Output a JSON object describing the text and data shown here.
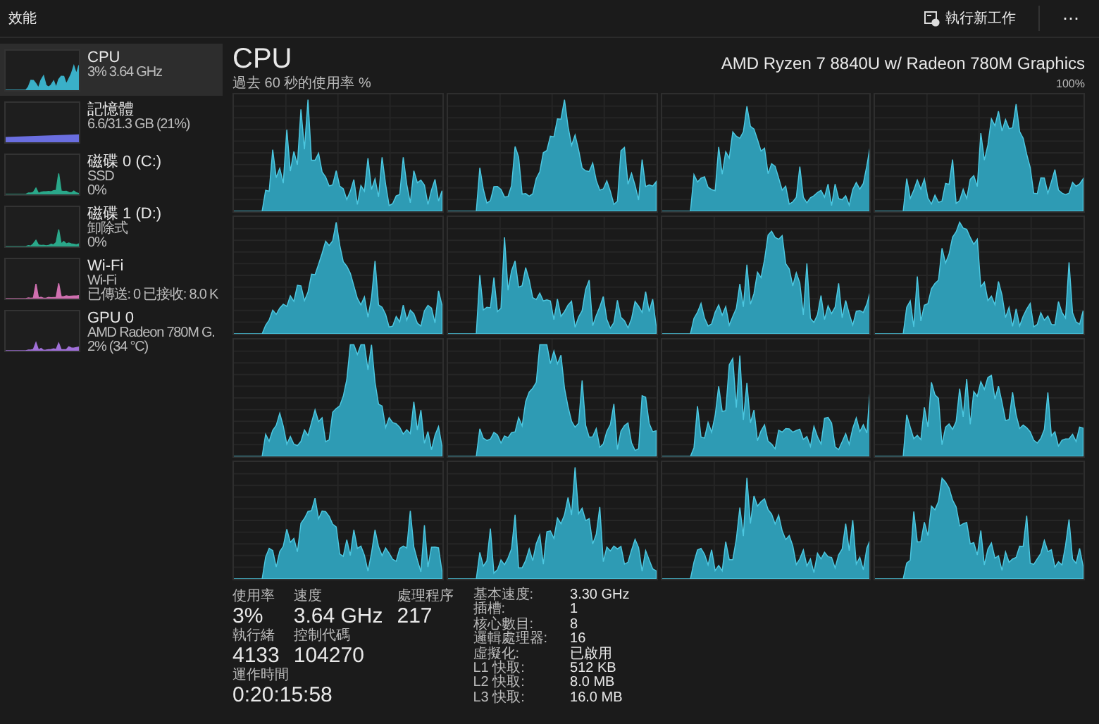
{
  "window": {
    "title": "效能"
  },
  "toolbar": {
    "run_task": "執行新工作",
    "more": "⋯"
  },
  "sidebar": {
    "items": [
      {
        "kind": "cpu",
        "title": "CPU",
        "lines": [
          "3%  3.64 GHz"
        ],
        "color": "#3ab0c8",
        "selected": true
      },
      {
        "kind": "memory",
        "title": "記憶體",
        "lines": [
          "6.6/31.3 GB (21%)"
        ],
        "color": "#6a6ee0",
        "selected": false
      },
      {
        "kind": "disk",
        "title": "磁碟 0 (C:)",
        "lines": [
          "SSD",
          "0%"
        ],
        "color": "#2aa88a",
        "selected": false
      },
      {
        "kind": "disk",
        "title": "磁碟 1 (D:)",
        "lines": [
          "卸除式",
          "0%"
        ],
        "color": "#2aa88a",
        "selected": false
      },
      {
        "kind": "network",
        "title": "Wi-Fi",
        "lines": [
          "Wi-Fi",
          "已傳送: 0 已接收: 8.0 K"
        ],
        "color": "#d070b0",
        "selected": false
      },
      {
        "kind": "gpu",
        "title": "GPU 0",
        "lines": [
          "AMD Radeon 780M G.",
          "2% (34 °C)"
        ],
        "color": "#a070d8",
        "selected": false
      }
    ]
  },
  "main": {
    "title": "CPU",
    "model": "AMD Ryzen 7 8840U w/ Radeon 780M Graphics",
    "graph_label": "過去 60 秒的使用率 %",
    "graph_max": "100%",
    "stats": [
      {
        "label": "使用率",
        "value": "3%"
      },
      {
        "label": "速度",
        "value": "3.64 GHz"
      },
      {
        "label": "處理程序",
        "value": "217"
      },
      {
        "label": "執行緒",
        "value": "4133"
      },
      {
        "label": "控制代碼",
        "value": "104270"
      },
      {
        "label": "運作時間",
        "value": "0:20:15:58"
      }
    ],
    "details": [
      {
        "label": "基本速度:",
        "value": "3.30 GHz"
      },
      {
        "label": "插槽:",
        "value": "1"
      },
      {
        "label": "核心數目:",
        "value": "8"
      },
      {
        "label": "邏輯處理器:",
        "value": "16"
      },
      {
        "label": "虛擬化:",
        "value": "已啟用"
      },
      {
        "label": "L1 快取:",
        "value": "512 KB"
      },
      {
        "label": "L2 快取:",
        "value": "8.0 MB"
      },
      {
        "label": "L3 快取:",
        "value": "16.0 MB"
      }
    ]
  }
}
